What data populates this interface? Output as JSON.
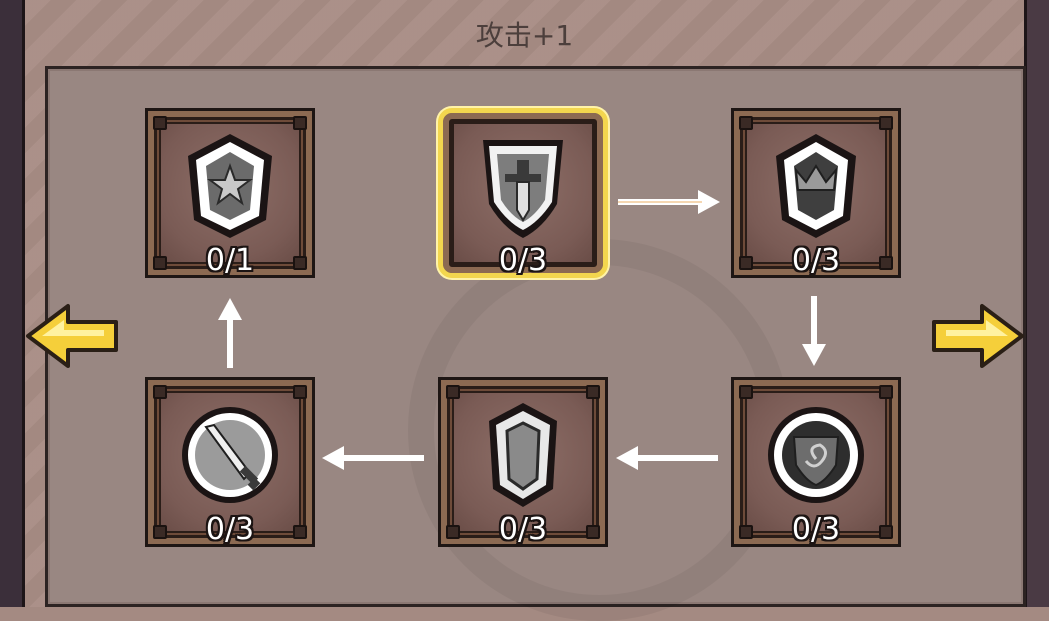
{
  "title": "攻击+1",
  "accent_color": "#f3d64e",
  "nodes": [
    {
      "id": "star-shield",
      "icon": "star-shield-icon",
      "count": "0/1"
    },
    {
      "id": "sword-banner",
      "icon": "sword-banner-icon",
      "count": "0/3",
      "selected": true
    },
    {
      "id": "crown-shield",
      "icon": "crown-shield-icon",
      "count": "0/3"
    },
    {
      "id": "spiral-shield",
      "icon": "spiral-shield-icon",
      "count": "0/3"
    },
    {
      "id": "plain-shield",
      "icon": "plain-shield-icon",
      "count": "0/3"
    },
    {
      "id": "sword-orb",
      "icon": "sword-orb-icon",
      "count": "0/3"
    }
  ],
  "navigation": {
    "left": "arrow-left-icon",
    "right": "arrow-right-icon"
  }
}
